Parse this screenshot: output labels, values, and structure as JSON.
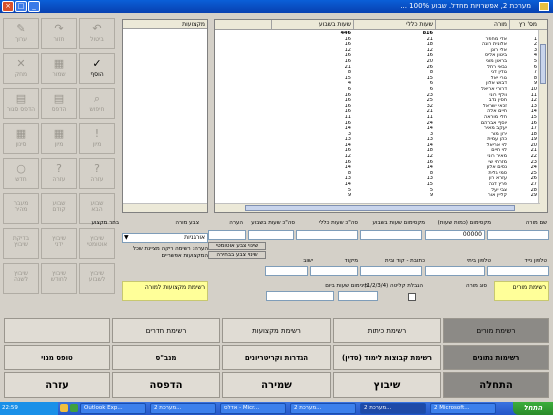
{
  "window": {
    "title": "מערכת 2, אפשרויות מחדל. שבוע 100% ..."
  },
  "toolbar": {
    "buttons": [
      {
        "id": "tb-1",
        "label": "ביטול",
        "icon": "↶",
        "enabled": false
      },
      {
        "id": "tb-2",
        "label": "חזור",
        "icon": "↷",
        "enabled": false
      },
      {
        "id": "tb-3",
        "label": "ערוך",
        "icon": "✎",
        "enabled": false
      },
      {
        "id": "tb-4",
        "label": "הוסף",
        "icon": "✓",
        "enabled": true
      },
      {
        "id": "tb-5",
        "label": "שמור",
        "icon": "▦",
        "enabled": false
      },
      {
        "id": "tb-6",
        "label": "מחק",
        "icon": "✕",
        "enabled": false
      },
      {
        "id": "tb-7",
        "label": "חיפוש",
        "icon": "⌕",
        "enabled": false
      },
      {
        "id": "tb-8",
        "label": "הדפס",
        "icon": "▤",
        "enabled": false
      },
      {
        "id": "tb-9",
        "label": "הדפס סגור",
        "icon": "▤",
        "enabled": false
      },
      {
        "id": "tb-10",
        "label": "מיון",
        "icon": "!",
        "enabled": false
      },
      {
        "id": "tb-11",
        "label": "מיון",
        "icon": "▦",
        "enabled": false
      },
      {
        "id": "tb-12",
        "label": "סינון",
        "icon": "▦",
        "enabled": false
      },
      {
        "id": "tb-13",
        "label": "עזרה",
        "icon": "?",
        "enabled": false
      },
      {
        "id": "tb-14",
        "label": "עזרה",
        "icon": "?",
        "enabled": false
      },
      {
        "id": "tb-15",
        "label": "חדש",
        "icon": "○",
        "enabled": false
      },
      {
        "id": "tb-16",
        "label": "שבוע\nהבא",
        "icon": "",
        "enabled": false
      },
      {
        "id": "tb-17",
        "label": "שבוע\nקודם",
        "icon": "",
        "enabled": false
      },
      {
        "id": "tb-18",
        "label": "מעבר\nמהיר",
        "icon": "",
        "enabled": false
      },
      {
        "id": "tb-19",
        "label": "שיבוץ\nאוטומטי",
        "icon": "",
        "enabled": false
      },
      {
        "id": "tb-20",
        "label": "שיבוץ\nידני",
        "icon": "",
        "enabled": false
      },
      {
        "id": "tb-21",
        "label": "בדיקת\nשיבוץ",
        "icon": "",
        "enabled": false
      },
      {
        "id": "tb-22",
        "label": "שיבוץ\nלשבוע",
        "icon": "",
        "enabled": false
      },
      {
        "id": "tb-23",
        "label": "שיבוץ\nלחודש",
        "icon": "",
        "enabled": false
      },
      {
        "id": "tb-24",
        "label": "שיבוץ\nלשנה",
        "icon": "",
        "enabled": false
      }
    ]
  },
  "side_list": {
    "header": "מקצועות"
  },
  "grid": {
    "headers": {
      "num": "מס' רץ",
      "name": "מורה",
      "total": "שעות כללי",
      "week": "שעות בשבוע"
    },
    "totals": {
      "total": "816",
      "week": "446"
    },
    "rows": [
      {
        "num": "1",
        "name": "אדי מחפר",
        "total": "21",
        "week": "16"
      },
      {
        "num": "2",
        "name": "אלונית רונה",
        "total": "18",
        "week": "16"
      },
      {
        "num": "3",
        "name": "אלי רונן",
        "total": "12",
        "week": "12"
      },
      {
        "num": "4",
        "name": "ביטון אליס",
        "total": "16",
        "week": "16"
      },
      {
        "num": "5",
        "name": "בראון מוני",
        "total": "20",
        "week": "16"
      },
      {
        "num": "6",
        "name": "גבאי רחל",
        "total": "26",
        "week": "21"
      },
      {
        "num": "7",
        "name": "גודין דני",
        "total": "8",
        "week": "8"
      },
      {
        "num": "8",
        "name": "גורי יאל",
        "total": "15",
        "week": "15"
      },
      {
        "num": "9",
        "name": "דבוש אלון",
        "total": "6",
        "week": "4"
      },
      {
        "num": "10",
        "name": "דרורי אריאל",
        "total": "6",
        "week": "6"
      },
      {
        "num": "11",
        "name": "וולף רוני",
        "total": "23",
        "week": "16"
      },
      {
        "num": "12",
        "name": "חסין נדב",
        "total": "25",
        "week": "16"
      },
      {
        "num": "13",
        "name": "זכאי ישראל",
        "total": "32",
        "week": "16"
      },
      {
        "num": "14",
        "name": "חיים אלה",
        "total": "21",
        "week": "16"
      },
      {
        "num": "15",
        "name": "חלי מוראה",
        "total": "11",
        "week": "11"
      },
      {
        "num": "16",
        "name": "יוסף אברהם",
        "total": "24",
        "week": "16"
      },
      {
        "num": "17",
        "name": "יעקב מאיר",
        "total": "14",
        "week": "14"
      },
      {
        "num": "18",
        "name": "ירון מור",
        "total": "3",
        "week": "3"
      },
      {
        "num": "19",
        "name": "כהן עמית",
        "total": "13",
        "week": "13"
      },
      {
        "num": "20",
        "name": "לוי אריאל",
        "total": "14",
        "week": "14"
      },
      {
        "num": "21",
        "name": "לוי חיים",
        "total": "18",
        "week": "16"
      },
      {
        "num": "22",
        "name": "מאיר רוני",
        "total": "12",
        "week": "12"
      },
      {
        "num": "23",
        "name": "מזרחי שי",
        "total": "16",
        "week": "16"
      },
      {
        "num": "24",
        "name": "נסים אלון",
        "total": "14",
        "week": "14"
      },
      {
        "num": "25",
        "name": "סמי גלית",
        "total": "8",
        "week": "8"
      },
      {
        "num": "26",
        "name": "עזרא רון",
        "total": "13",
        "week": "13"
      },
      {
        "num": "27",
        "name": "פרץ דנה",
        "total": "15",
        "week": "14"
      },
      {
        "num": "28",
        "name": "צבי יעל",
        "total": "5",
        "week": "5"
      },
      {
        "num": "29",
        "name": "קליין אור",
        "total": "9",
        "week": "9"
      }
    ]
  },
  "form": {
    "labels": {
      "teacher_name": "שם מורה",
      "id_number": "מספר ת.ז.",
      "hours_total_limit": "מקסימום (כמות שעות)",
      "hours_week_limit": "מקסימום שעות בשבוע",
      "total_hours": "סה\"כ שעות כללי",
      "weekly_hours": "סה\"כ שעות בשבוע",
      "notes": "הערה",
      "color_code": "צבע מורה",
      "main_subject": "בחר מקצוע",
      "phone_home": "טלפון ביתי",
      "phone_mobile": "טלפון נייד",
      "address": "כתובת - קוד ובית",
      "city": "ישוב",
      "postal": "מיקוד",
      "email": "דוא\"ל",
      "teacher_type": "סוג מורה",
      "min_day_hours": "מינימום שעות ביום",
      "max_day_hours": "מינימום שעות ביום",
      "counter": "הגבלת קליטה (1/2/3/4)",
      "limit_days": "מגבלת ימים לקבוצות"
    },
    "values": {
      "teacher_name": "",
      "id_number": "00000",
      "main_subject": "אורגניות"
    },
    "buttons": {
      "set_color": "שינוי צבע אוטומטי",
      "change_color": "שינוי צבע בבחירה"
    },
    "note_text": "הערה: רשימה ריקה מציינת שכל המקצועות אפשריים",
    "yellow_left": "רשימת מקצועות למורה",
    "yellow_right": "רשימת מורים"
  },
  "nav": {
    "row1": [
      "רשימת מורים",
      "רשימת כיתות",
      "רשימת מקצועות",
      "רשימת חדרים"
    ],
    "row2": [
      "רשימות נתונים",
      "רשימת קבוצות לימוד (סדין)",
      "הגדרות וקריטריונים",
      "מנב\"ס",
      "טופס מנוי"
    ],
    "row3": [
      "התחלה",
      "שיבוץ",
      "שמירה",
      "הדפסה",
      "עזרה"
    ]
  },
  "taskbar": {
    "start": "התחל",
    "tasks": [
      "Outlook Exp...",
      "מערכת 2...",
      "אדלס - Micr...",
      "מערכת 2...",
      "מערכת 2...",
      "2 Microsoft..."
    ],
    "clock": "22:59"
  },
  "colors": {
    "accent": "#0a5fd8",
    "yellow": "#ffff99",
    "nav_dark": "#8c8a86"
  }
}
